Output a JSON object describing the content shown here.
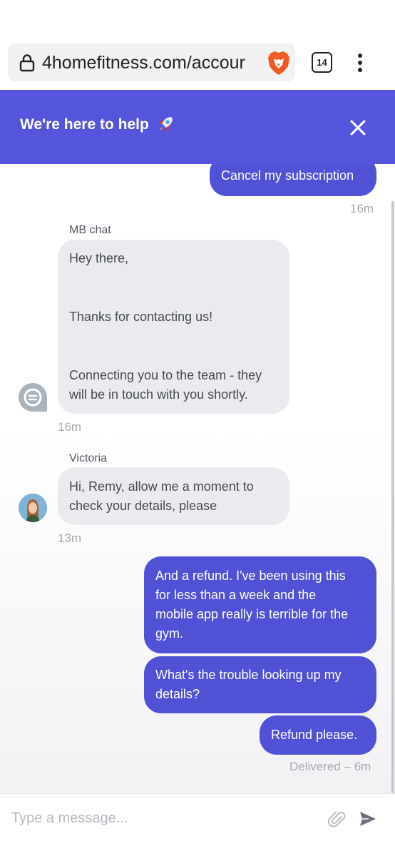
{
  "browser": {
    "url": "4homefitness.com/accour",
    "tab_count": "14"
  },
  "widget": {
    "header_title": "We're here to help",
    "header_emoji_icon": "rocket-icon",
    "accent_color": "#5555db"
  },
  "messages": {
    "m1": {
      "text": "Cancel my subscription",
      "time": "16m"
    },
    "m2": {
      "sender": "MB chat",
      "line1": "Hey there,",
      "line2": "Thanks for contacting us!",
      "line3a": "Connecting you to the team - they",
      "line3b": "will be in touch with you shortly.",
      "time": "16m"
    },
    "m3": {
      "sender": "Victoria",
      "line1": "Hi, Remy, allow me a moment to",
      "line2": "check your details, please",
      "time": "13m"
    },
    "m4": {
      "line1": "And a refund. I've been using this",
      "line2": "for less than a week and the",
      "line3": "mobile app really is terrible for the",
      "line4": "gym."
    },
    "m5": {
      "line1": "What's the trouble looking up my",
      "line2": "details?"
    },
    "m6": {
      "text": "Refund please.",
      "status": "Delivered – 6m"
    }
  },
  "composer": {
    "placeholder": "Type a message..."
  }
}
